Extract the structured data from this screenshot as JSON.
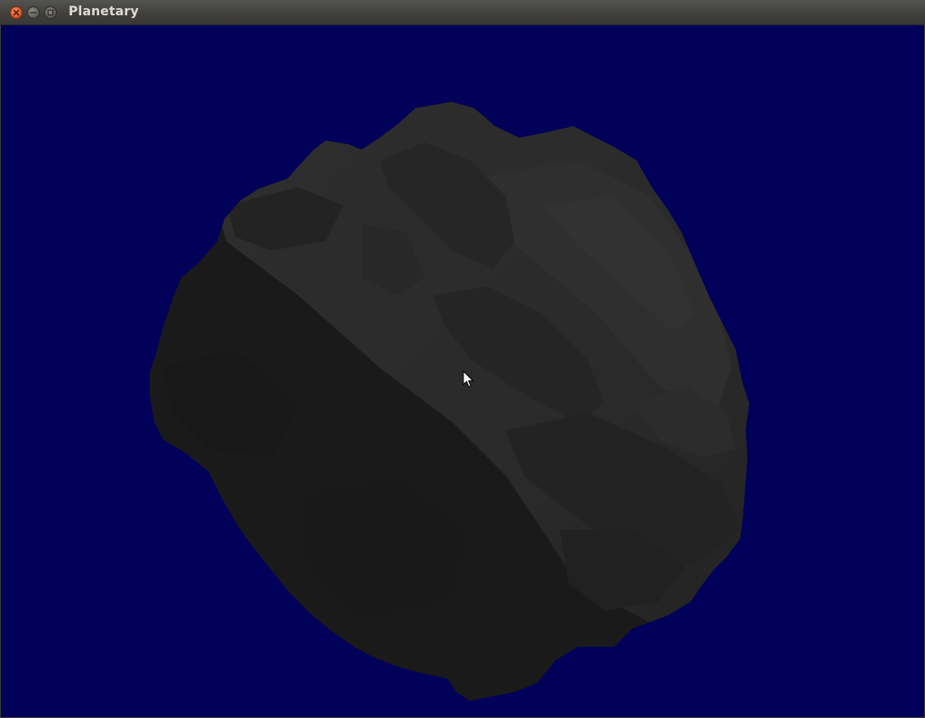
{
  "window": {
    "title": "Planetary",
    "controls": [
      "close",
      "minimize",
      "maximize"
    ]
  },
  "viewport": {
    "background": "#01015a"
  },
  "icons": {
    "close": "close-icon",
    "minimize": "minimize-icon",
    "maximize": "maximize-icon",
    "cursor": "mouse-pointer-icon"
  }
}
